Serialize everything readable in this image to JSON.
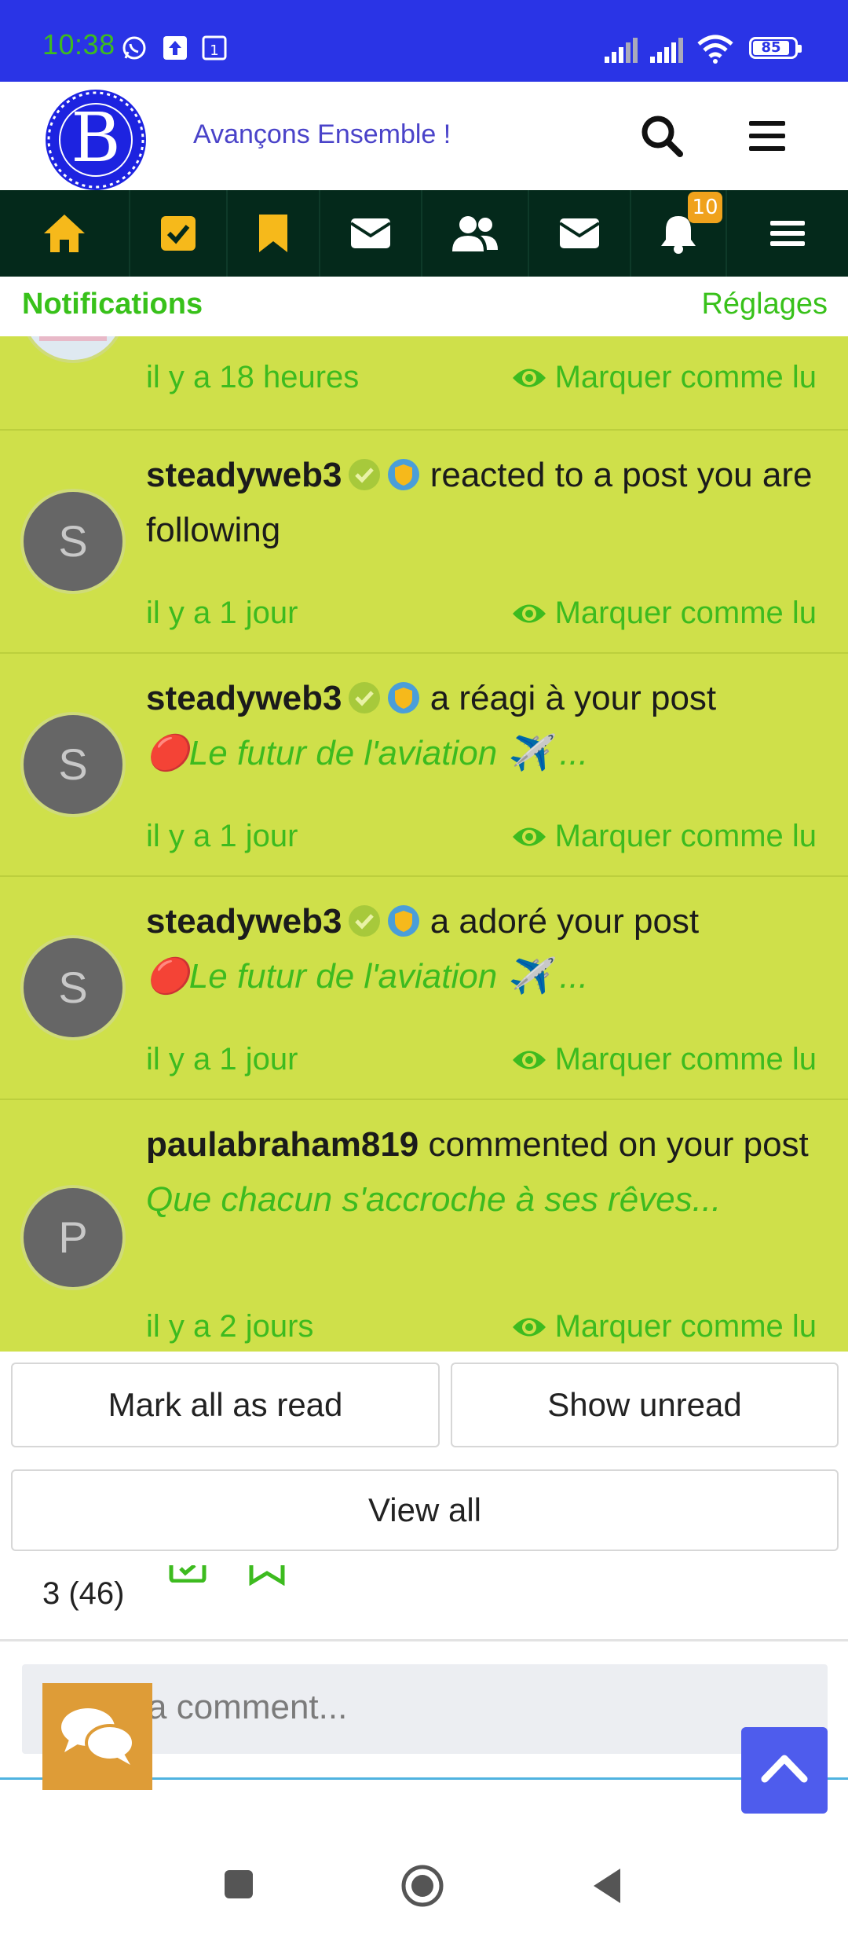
{
  "status_bar": {
    "time": "10:38",
    "battery": "85"
  },
  "header": {
    "logo_letter": "B",
    "tagline": "Avançons Ensemble !"
  },
  "nav": {
    "notification_count": "10"
  },
  "notifications_panel": {
    "title": "Notifications",
    "settings": "Réglages",
    "items": [
      {
        "time": "il y a 18 heures",
        "mark": "Marquer comme lu"
      },
      {
        "avatar": "S",
        "user": "steadyweb3",
        "action": "reacted to a post you are following",
        "time": "il y a 1 jour",
        "mark": "Marquer comme lu"
      },
      {
        "avatar": "S",
        "user": "steadyweb3",
        "action": "a réagi à your post",
        "preview": "🔴Le futur de l'aviation ✈️ ...",
        "time": "il y a 1 jour",
        "mark": "Marquer comme lu"
      },
      {
        "avatar": "S",
        "user": "steadyweb3",
        "action": "a adoré your post",
        "preview": "🔴Le futur de l'aviation ✈️ ...",
        "time": "il y a 1 jour",
        "mark": "Marquer comme lu"
      },
      {
        "avatar": "P",
        "user": "paulabraham819",
        "action": "commented on your post",
        "preview": "Que chacun s'accroche à ses rêves...",
        "time": "il y a 2 jours",
        "mark": "Marquer comme lu"
      }
    ],
    "buttons": {
      "mark_all": "Mark all as read",
      "show_unread": "Show unread",
      "view_all": "View all"
    }
  },
  "page": {
    "count": "3 (46)",
    "comment_placeholder": "a comment..."
  },
  "colors": {
    "status_bar": "#2a34e6",
    "nav_bg": "#04291b",
    "notif_bg": "#cfe04a",
    "accent_green": "#3dbb1f",
    "nav_icon_yellow": "#f6b91b"
  },
  "icons": [
    "whatsapp-icon",
    "upload-icon",
    "calendar-icon",
    "signal-icon",
    "wifi-icon",
    "search-icon",
    "menu-icon",
    "home-icon",
    "checkbox-icon",
    "bookmark-icon",
    "mail-icon",
    "users-icon",
    "bell-icon",
    "eye-icon",
    "chat-icon",
    "chevron-up-icon"
  ]
}
